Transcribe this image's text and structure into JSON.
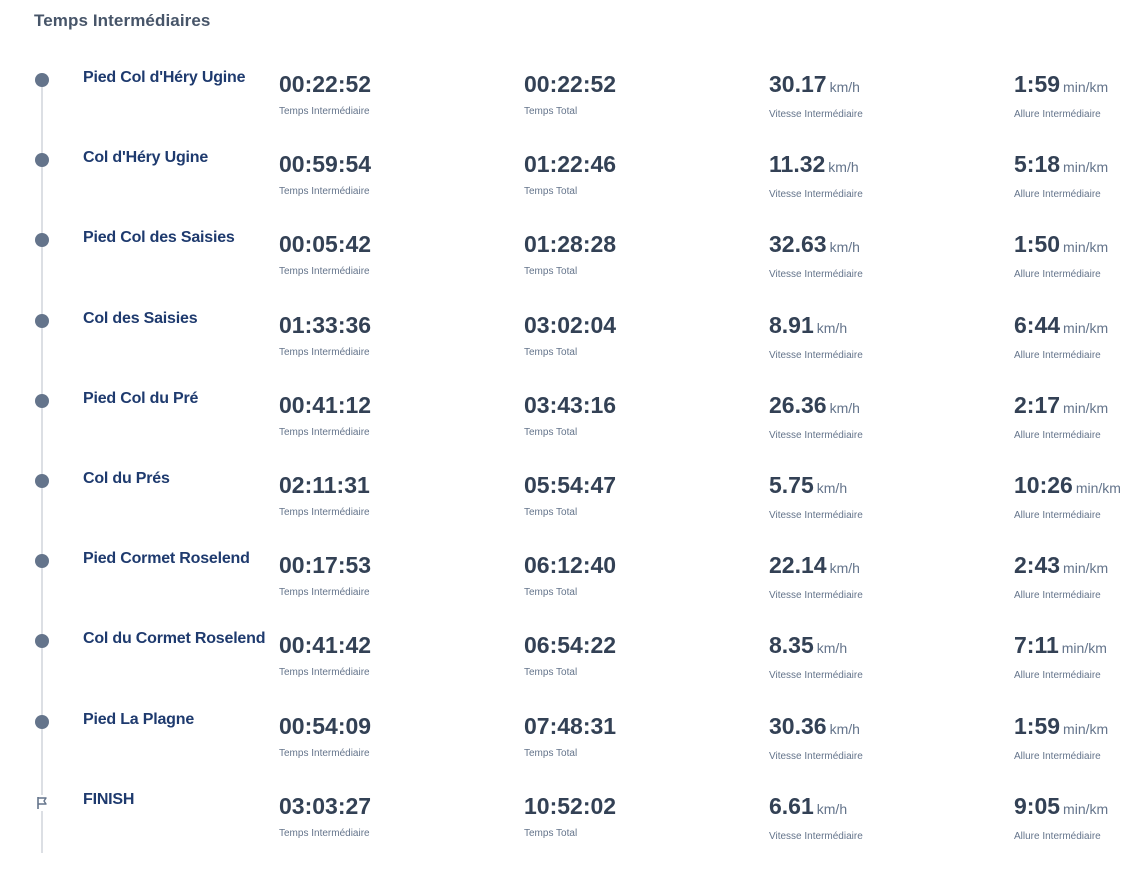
{
  "header": {
    "title": "Temps Intermédiaires"
  },
  "labels": {
    "split_time": "Temps Intermédiaire",
    "total_time": "Temps Total",
    "split_speed": "Vitesse Intermédiaire",
    "split_pace": "Allure Intermédiaire",
    "speed_unit": "km/h",
    "pace_unit": "min/km"
  },
  "icons": {
    "checkpoint": "dot-icon",
    "finish": "flag-icon"
  },
  "colors": {
    "name": "#1e3a6e",
    "value": "#334155",
    "muted": "#64748b",
    "timeline": "#dcdfe4"
  },
  "splits": [
    {
      "name": "Pied Col d'Héry Ugine",
      "split_time": "00:22:52",
      "total_time": "00:22:52",
      "speed": "30.17",
      "pace": "1:59"
    },
    {
      "name": "Col d'Héry Ugine",
      "split_time": "00:59:54",
      "total_time": "01:22:46",
      "speed": "11.32",
      "pace": "5:18"
    },
    {
      "name": "Pied Col des Saisies",
      "split_time": "00:05:42",
      "total_time": "01:28:28",
      "speed": "32.63",
      "pace": "1:50"
    },
    {
      "name": "Col des Saisies",
      "split_time": "01:33:36",
      "total_time": "03:02:04",
      "speed": "8.91",
      "pace": "6:44"
    },
    {
      "name": "Pied Col du Pré",
      "split_time": "00:41:12",
      "total_time": "03:43:16",
      "speed": "26.36",
      "pace": "2:17"
    },
    {
      "name": "Col du Prés",
      "split_time": "02:11:31",
      "total_time": "05:54:47",
      "speed": "5.75",
      "pace": "10:26"
    },
    {
      "name": "Pied Cormet Roselend",
      "split_time": "00:17:53",
      "total_time": "06:12:40",
      "speed": "22.14",
      "pace": "2:43"
    },
    {
      "name": "Col du Cormet Roselend",
      "split_time": "00:41:42",
      "total_time": "06:54:22",
      "speed": "8.35",
      "pace": "7:11"
    },
    {
      "name": "Pied La Plagne",
      "split_time": "00:54:09",
      "total_time": "07:48:31",
      "speed": "30.36",
      "pace": "1:59"
    },
    {
      "name": "FINISH",
      "split_time": "03:03:27",
      "total_time": "10:52:02",
      "speed": "6.61",
      "pace": "9:05"
    }
  ]
}
